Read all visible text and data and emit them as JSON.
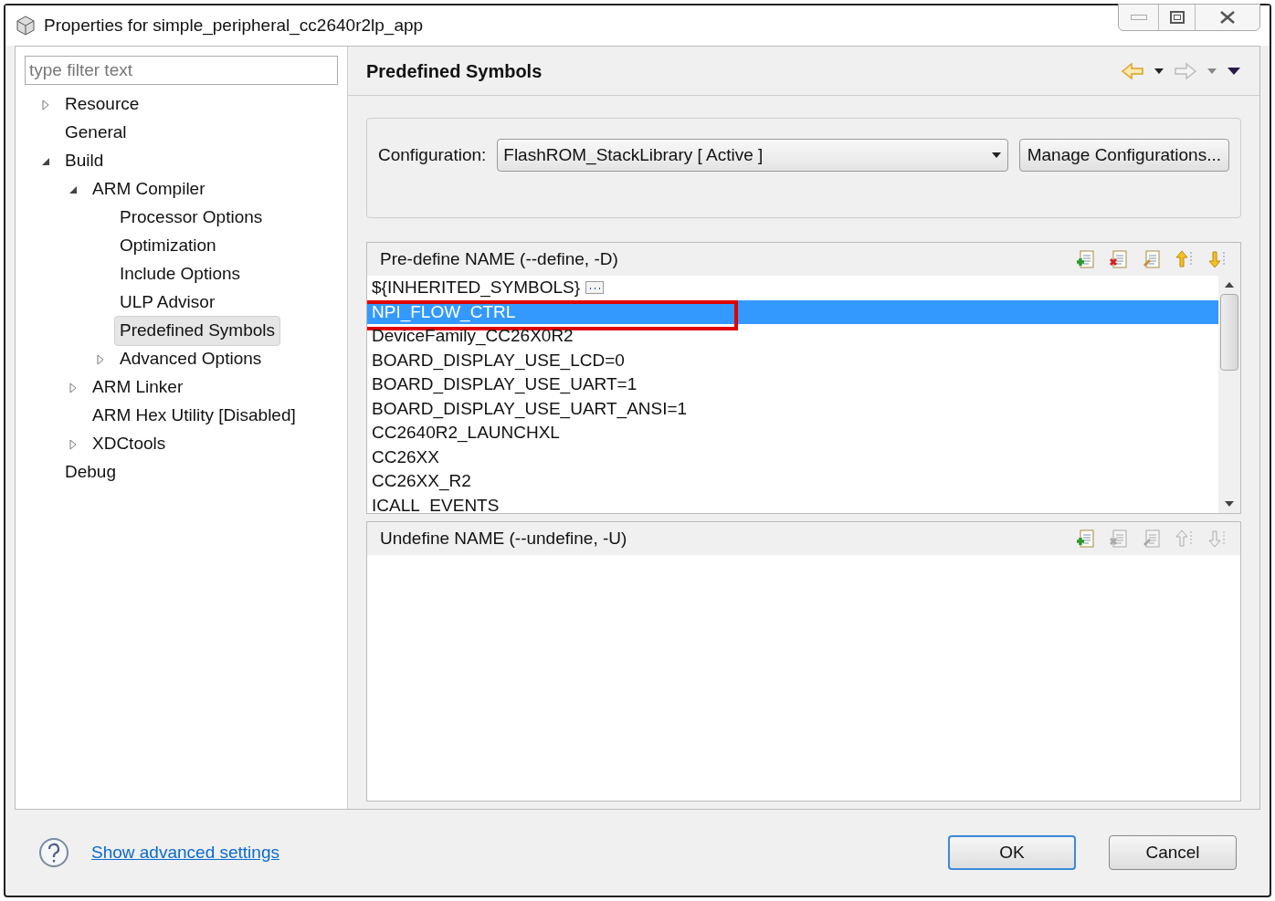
{
  "window": {
    "title": "Properties for simple_peripheral_cc2640r2lp_app"
  },
  "filter": {
    "placeholder": "type filter text"
  },
  "tree": [
    {
      "label": "Resource",
      "expanded": false,
      "selected": false
    },
    {
      "label": "General",
      "selected": false
    },
    {
      "label": "Build",
      "expanded": true,
      "selected": false,
      "children": [
        {
          "label": "ARM Compiler",
          "expanded": true,
          "selected": false,
          "children": [
            {
              "label": "Processor Options",
              "selected": false
            },
            {
              "label": "Optimization",
              "selected": false
            },
            {
              "label": "Include Options",
              "selected": false
            },
            {
              "label": "ULP Advisor",
              "selected": false
            },
            {
              "label": "Predefined Symbols",
              "selected": true
            },
            {
              "label": "Advanced Options",
              "expanded": false,
              "selected": false
            }
          ]
        },
        {
          "label": "ARM Linker",
          "expanded": false,
          "selected": false
        },
        {
          "label": "ARM Hex Utility  [Disabled]",
          "selected": false
        },
        {
          "label": "XDCtools",
          "expanded": false,
          "selected": false
        }
      ]
    },
    {
      "label": "Debug",
      "selected": false
    }
  ],
  "page": {
    "title": "Predefined Symbols"
  },
  "configuration": {
    "label": "Configuration:",
    "value": "FlashROM_StackLibrary  [ Active ]",
    "button": "Manage Configurations..."
  },
  "define_list": {
    "title": "Pre-define NAME (--define, -D)",
    "tools": [
      {
        "kind": "add",
        "disabled": false
      },
      {
        "kind": "delete",
        "disabled": false
      },
      {
        "kind": "edit",
        "disabled": false
      },
      {
        "kind": "up",
        "disabled": false
      },
      {
        "kind": "down",
        "disabled": false
      }
    ],
    "items": [
      {
        "text": "${INHERITED_SYMBOLS}",
        "kind": "inherited",
        "selected": false
      },
      {
        "text": "NPI_FLOW_CTRL",
        "selected": true,
        "highlighted": true
      },
      {
        "text": "DeviceFamily_CC26X0R2",
        "selected": false
      },
      {
        "text": "BOARD_DISPLAY_USE_LCD=0",
        "selected": false
      },
      {
        "text": "BOARD_DISPLAY_USE_UART=1",
        "selected": false
      },
      {
        "text": "BOARD_DISPLAY_USE_UART_ANSI=1",
        "selected": false
      },
      {
        "text": "CC2640R2_LAUNCHXL",
        "selected": false
      },
      {
        "text": "CC26XX",
        "selected": false
      },
      {
        "text": "CC26XX_R2",
        "selected": false
      },
      {
        "text": "ICALL_EVENTS",
        "selected": false
      }
    ]
  },
  "undefine_list": {
    "title": "Undefine NAME (--undefine, -U)",
    "tools": [
      {
        "kind": "add",
        "disabled": false
      },
      {
        "kind": "delete",
        "disabled": true
      },
      {
        "kind": "edit",
        "disabled": true
      },
      {
        "kind": "up",
        "disabled": true
      },
      {
        "kind": "down",
        "disabled": true
      }
    ]
  },
  "footer": {
    "link": "Show advanced settings",
    "buttons": [
      {
        "label": "OK",
        "default": true
      },
      {
        "label": "Cancel",
        "default": false
      }
    ]
  }
}
